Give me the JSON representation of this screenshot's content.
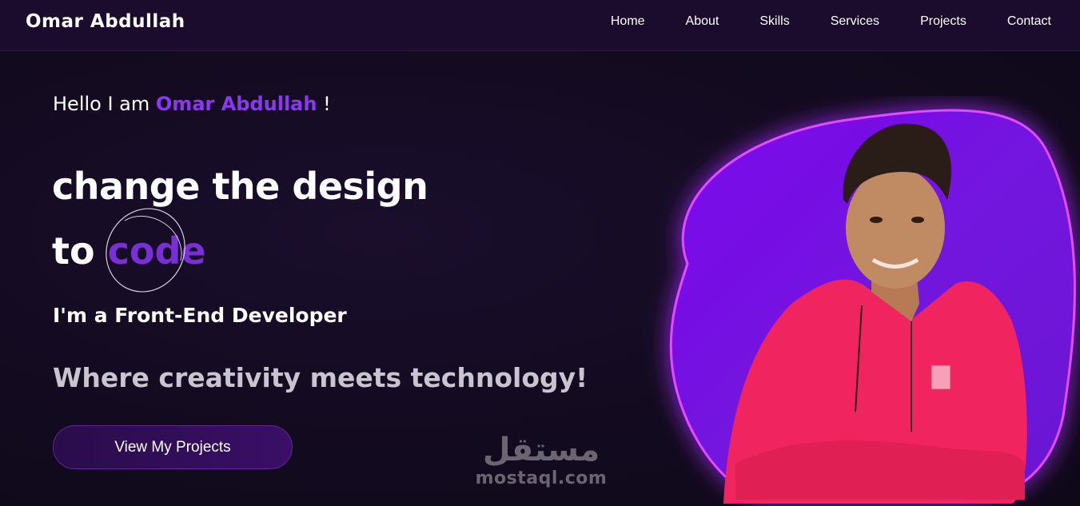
{
  "nav": {
    "brand": "Omar Abdullah",
    "links": [
      "Home",
      "About",
      "Skills",
      "Services",
      "Projects",
      "Contact"
    ]
  },
  "hero": {
    "greeting_prefix": "Hello I am",
    "greeting_name": "Omar Abdullah",
    "greeting_suffix": "!",
    "headline_line1": "change the design",
    "headline_line2_prefix": "to",
    "headline_highlight": "code",
    "role": "I'm a Front-End Developer",
    "tagline": "Where creativity meets technology!",
    "cta_label": "View My Projects"
  },
  "watermark": {
    "arabic": "مستقل",
    "latin": "mostaql.com"
  },
  "colors": {
    "accent": "#8a38f5",
    "blob": "#7a14e6",
    "hoodie": "#f0245f",
    "background": "#130a1f"
  }
}
